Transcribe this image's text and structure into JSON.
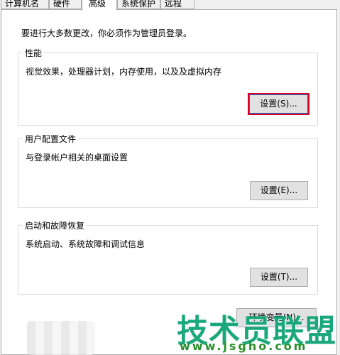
{
  "tabs": [
    {
      "label": "计算机名",
      "active": false
    },
    {
      "label": "硬件",
      "active": false
    },
    {
      "label": "高级",
      "active": true
    },
    {
      "label": "系统保护",
      "active": false
    },
    {
      "label": "远程",
      "active": false
    }
  ],
  "intro": "要进行大多数更改，你必须作为管理员登录。",
  "groups": {
    "performance": {
      "title": "性能",
      "description": "视觉效果，处理器计划，内存使用，以及及虚拟内存",
      "button": "设置(S)..."
    },
    "user_profiles": {
      "title": "用户配置文件",
      "description": "与登录帐户相关的桌面设置",
      "button": "设置(E)..."
    },
    "startup_recovery": {
      "title": "启动和故障恢复",
      "description": "系统启动、系统故障和调试信息",
      "button": "设置(T)..."
    }
  },
  "env_button": "环境变量(N)...",
  "watermark": {
    "line1": "技术员联盟",
    "line2": "www.jsgho.com"
  },
  "colors": {
    "focus_outline": "#d80027",
    "watermark_green": "#1aa87a"
  }
}
